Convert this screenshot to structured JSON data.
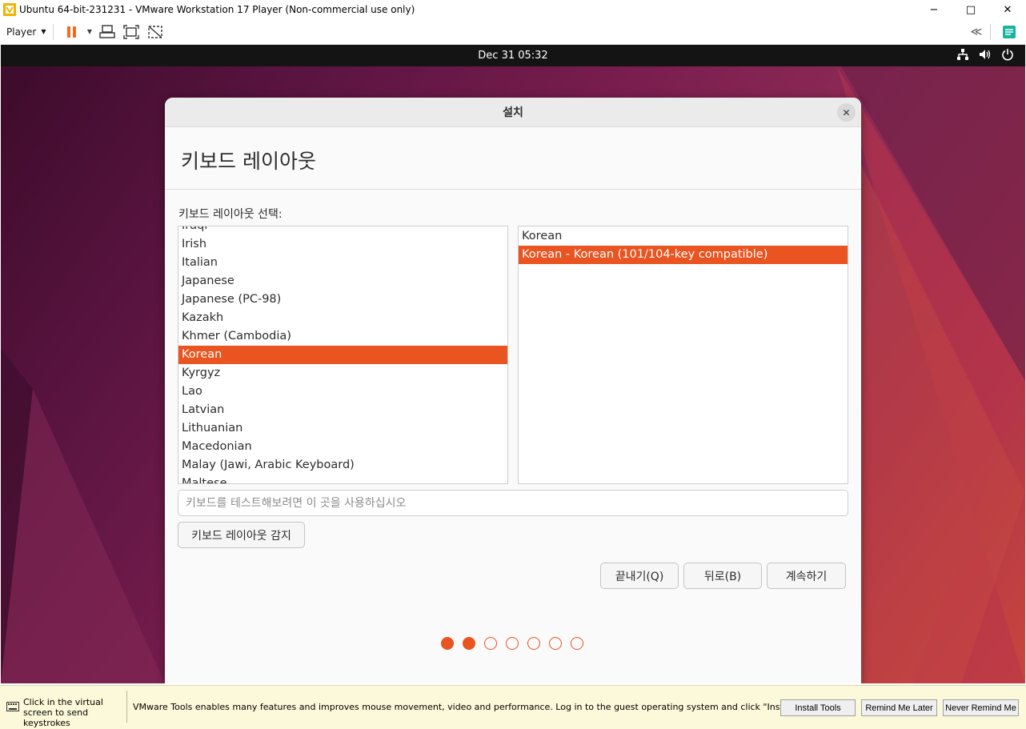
{
  "window": {
    "title": "Ubuntu 64-bit-231231 - VMware Workstation 17 Player (Non-commercial use only)",
    "minimize_glyph": "−",
    "maximize_glyph": "□",
    "close_glyph": "✕"
  },
  "toolbar": {
    "player_label": "Player",
    "icons": [
      "pause-icon",
      "dropdown-icon",
      "send-ctrl-alt-del-icon",
      "fullscreen-icon",
      "unity-icon",
      "collapse-icon",
      "notes-icon"
    ]
  },
  "guest_topbar": {
    "clock": "Dec 31  05:32",
    "icons": [
      "network-icon",
      "volume-icon",
      "power-icon"
    ]
  },
  "installer": {
    "header_title": "설치",
    "close_glyph": "✕",
    "page_heading": "키보드 레이아웃",
    "select_label": "키보드 레이아웃 선택:",
    "layouts": [
      {
        "label": "Iraqi",
        "selected": false
      },
      {
        "label": "Irish",
        "selected": false
      },
      {
        "label": "Italian",
        "selected": false
      },
      {
        "label": "Japanese",
        "selected": false
      },
      {
        "label": "Japanese (PC-98)",
        "selected": false
      },
      {
        "label": "Kazakh",
        "selected": false
      },
      {
        "label": "Khmer (Cambodia)",
        "selected": false
      },
      {
        "label": "Korean",
        "selected": true
      },
      {
        "label": "Kyrgyz",
        "selected": false
      },
      {
        "label": "Lao",
        "selected": false
      },
      {
        "label": "Latvian",
        "selected": false
      },
      {
        "label": "Lithuanian",
        "selected": false
      },
      {
        "label": "Macedonian",
        "selected": false
      },
      {
        "label": "Malay (Jawi, Arabic Keyboard)",
        "selected": false
      },
      {
        "label": "Maltese",
        "selected": false
      }
    ],
    "variants": [
      {
        "label": "Korean",
        "selected": false
      },
      {
        "label": "Korean - Korean (101/104-key compatible)",
        "selected": true
      }
    ],
    "test_input": {
      "value": "",
      "placeholder": "키보드를 테스트해보려면 이 곳을 사용하십시오"
    },
    "detect_button": "키보드 레이아웃 감지",
    "quit_button": "끝내기(Q)",
    "back_button": "뒤로(B)",
    "continue_button": "계속하기",
    "progress": {
      "total_steps": 7,
      "current_step": 2
    },
    "accent_color": "#e95420"
  },
  "statusbar": {
    "hint": "Click in the virtual screen to send keystrokes",
    "message": "VMware Tools enables many features and improves mouse movement, video and performance. Log in to the guest operating system and click \"Install Tools\".",
    "install_tools": "Install Tools",
    "remind_later": "Remind Me Later",
    "never_remind": "Never Remind Me"
  }
}
